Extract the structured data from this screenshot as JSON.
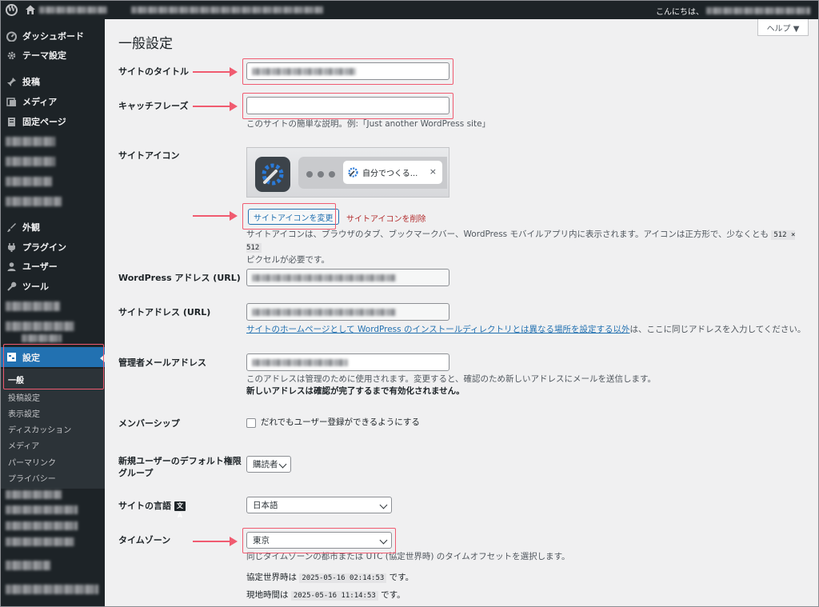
{
  "adminbar": {
    "greeting": "こんにちは、"
  },
  "sidebar": {
    "items": [
      {
        "label": "ダッシュボード",
        "icon": "dashboard-icon"
      },
      {
        "label": "テーマ設定",
        "icon": "gear-icon"
      },
      {
        "label": "投稿",
        "icon": "pin-icon"
      },
      {
        "label": "メディア",
        "icon": "media-icon"
      },
      {
        "label": "固定ページ",
        "icon": "page-icon"
      },
      {
        "label": "外観",
        "icon": "brush-icon"
      },
      {
        "label": "プラグイン",
        "icon": "plugin-icon"
      },
      {
        "label": "ユーザー",
        "icon": "user-icon"
      },
      {
        "label": "ツール",
        "icon": "wrench-icon"
      },
      {
        "label": "設定",
        "icon": "settings-icon"
      }
    ],
    "submenu": [
      "一般",
      "投稿設定",
      "表示設定",
      "ディスカッション",
      "メディア",
      "パーマリンク",
      "プライバシー"
    ]
  },
  "page": {
    "title": "一般設定",
    "help": "ヘルプ ▼"
  },
  "fields": {
    "site_title": {
      "label": "サイトのタイトル"
    },
    "tagline": {
      "label": "キャッチフレーズ",
      "desc": "このサイトの簡単な説明。例:「Just another WordPress site」"
    },
    "site_icon": {
      "label": "サイトアイコン",
      "preview_tab": "自分でつくる...",
      "preview_close": "×",
      "change_button": "サイトアイコンを変更",
      "delete_link": "サイトアイコンを削除",
      "desc_before": "サイトアイコンは、ブラウザのタブ、ブックマークバー、WordPress モバイルアプリ内に表示されます。アイコンは正方形で、少なくとも ",
      "desc_code": "512 × 512",
      "desc_after": "ピクセルが必要です。"
    },
    "wp_address": {
      "label": "WordPress アドレス (URL)"
    },
    "site_address": {
      "label": "サイトアドレス (URL)",
      "desc_link": "サイトのホームページとして WordPress のインストールディレクトリとは異なる場所を設定する以外",
      "desc_after": "は、ここに同じアドレスを入力してください。"
    },
    "admin_email": {
      "label": "管理者メールアドレス",
      "desc_before": "このアドレスは管理のために使用されます。変更すると、確認のため新しいアドレスにメールを送信します。",
      "desc_bold": "新しいアドレスは確認が完了するまで有効化されません。"
    },
    "membership": {
      "label": "メンバーシップ",
      "checkbox_label": "だれでもユーザー登録ができるようにする",
      "checked": false
    },
    "default_role": {
      "label_line1": "新規ユーザーのデフォルト権限",
      "label_line2": "グループ",
      "value": "購読者"
    },
    "language": {
      "label": "サイトの言語",
      "value": "日本語",
      "icon": "translate-icon"
    },
    "timezone": {
      "label": "タイムゾーン",
      "value": "東京",
      "desc": "同じタイムゾーンの都市または UTC (協定世界時) のタイムオフセットを選択します。",
      "utc_label": "協定世界時は",
      "utc_value": "2025-05-16 02:14:53",
      "utc_suffix": "です。",
      "local_label": "現地時間は",
      "local_value": "2025-05-16 11:14:53",
      "local_suffix": "です。"
    }
  },
  "colors": {
    "accent": "#2271b1",
    "sidebar": "#1d2327",
    "highlight": "#f05b70",
    "danger": "#b32d2e"
  }
}
